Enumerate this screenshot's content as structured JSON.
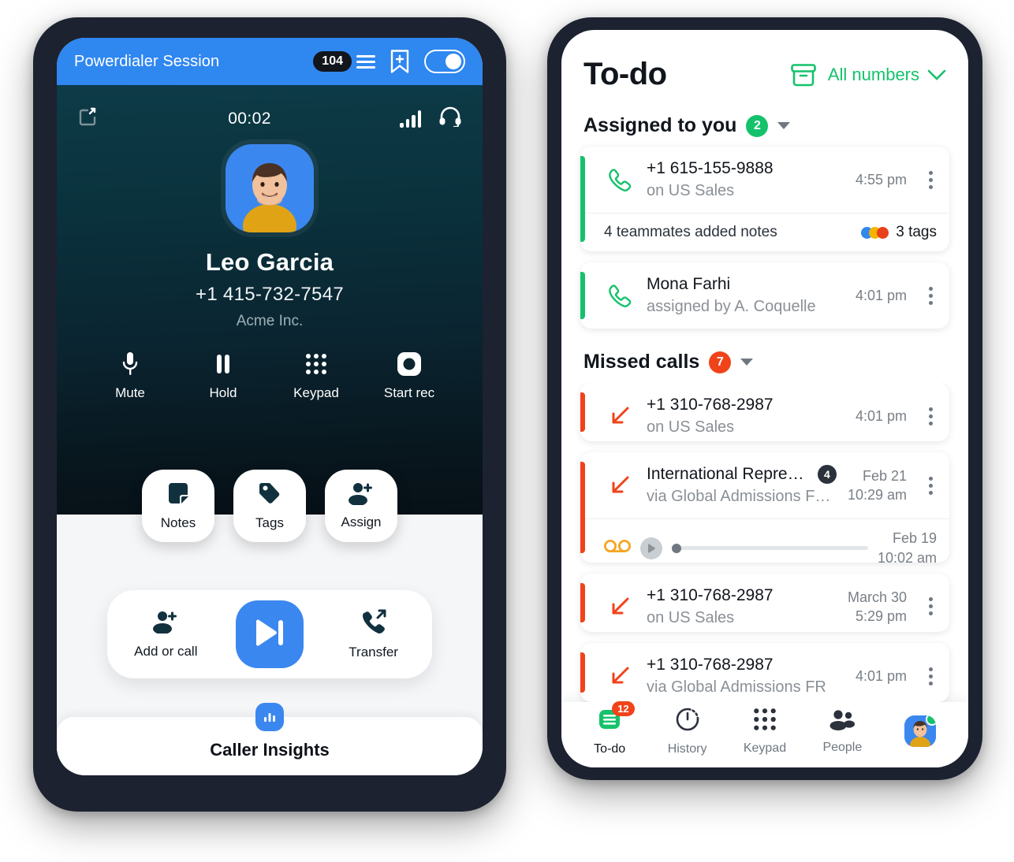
{
  "powerdialer": {
    "header": {
      "title": "Powerdialer Session",
      "queue_count": "104",
      "menu_icon": "hamburger-menu-icon",
      "bookmark_icon": "bookmark-add-icon",
      "toggle_state": "on"
    },
    "call": {
      "minimize_icon": "minimize-icon",
      "timer": "00:02",
      "signal_icon": "signal-bars-icon",
      "headset_icon": "headset-icon",
      "contact_name": "Leo Garcia",
      "contact_phone": "+1 415-732-7547",
      "contact_org": "Acme Inc.",
      "avatar_name": "contact-avatar"
    },
    "actions": [
      {
        "label": "Mute",
        "icon": "microphone-icon"
      },
      {
        "label": "Hold",
        "icon": "pause-icon"
      },
      {
        "label": "Keypad",
        "icon": "dialpad-icon"
      },
      {
        "label": "Start rec",
        "icon": "record-icon"
      }
    ],
    "pills": [
      {
        "label": "Notes",
        "icon": "note-icon"
      },
      {
        "label": "Tags",
        "icon": "tag-icon"
      },
      {
        "label": "Assign",
        "icon": "person-add-icon"
      }
    ],
    "dock": {
      "add_or_call": {
        "label": "Add or call",
        "icon": "person-add-icon"
      },
      "next_call": {
        "label": "",
        "icon": "skip-next-icon"
      },
      "transfer": {
        "label": "Transfer",
        "icon": "call-transfer-icon"
      }
    },
    "insights": {
      "label": "Caller Insights",
      "icon": "bar-chart-icon"
    },
    "colors": {
      "header_blue": "#2f87f0",
      "accent_blue": "#3b87f0",
      "call_bg_top": "#0d3b47",
      "call_bg_bottom": "#071017"
    }
  },
  "todo": {
    "header": {
      "title": "To-do",
      "archive_icon": "archive-box-icon",
      "filter_label": "All numbers",
      "filter_chevron_icon": "chevron-down-icon"
    },
    "sections": [
      {
        "title": "Assigned to you",
        "count": "2",
        "badge_color": "#15c26b",
        "caret_icon": "caret-down-icon",
        "items": [
          {
            "accent": "green",
            "icon": "phone-missed-inbound-icon",
            "title": "+1 615-155-9888",
            "subtitle": "on US Sales",
            "time": "4:55 pm",
            "time2": "",
            "count_badge": "",
            "kebab_icon": "more-vertical-icon",
            "footer": {
              "text": "4 teammates added notes",
              "tags_label": "3 tags",
              "tag_colors": [
                "#2f87f0",
                "#f4b400",
                "#e8411c"
              ]
            }
          },
          {
            "accent": "green",
            "icon": "phone-icon",
            "title": "Mona Farhi",
            "subtitle": "assigned by A. Coquelle",
            "time": "4:01 pm",
            "time2": "",
            "count_badge": "",
            "kebab_icon": "more-vertical-icon",
            "footer": null
          }
        ]
      },
      {
        "title": "Missed calls",
        "count": "7",
        "badge_color": "#f0431a",
        "caret_icon": "caret-down-icon",
        "items": [
          {
            "accent": "red",
            "icon": "call-missed-icon",
            "title": "+1 310-768-2987",
            "subtitle": "on US Sales",
            "time": "4:01 pm",
            "time2": "",
            "count_badge": "",
            "kebab_icon": "more-vertical-icon",
            "footer": null
          },
          {
            "accent": "red",
            "icon": "call-missed-icon",
            "title": "International Representat...",
            "subtitle": "via Global Admissions FR [In...",
            "time": "Feb 21",
            "time2": "10:29 am",
            "count_badge": "4",
            "kebab_icon": "more-vertical-icon",
            "voicemail": {
              "icon": "voicemail-icon",
              "play_icon": "play-icon",
              "progress": 3,
              "date": "Feb 19",
              "time": "10:02 am"
            },
            "footer": null
          },
          {
            "accent": "red",
            "icon": "call-missed-icon",
            "title": "+1 310-768-2987",
            "subtitle": "on US Sales",
            "time": "March 30",
            "time2": "5:29 pm",
            "count_badge": "",
            "kebab_icon": "more-vertical-icon",
            "footer": null
          },
          {
            "accent": "red",
            "icon": "call-missed-icon",
            "title": "+1 310-768-2987",
            "subtitle": "via Global Admissions FR",
            "time": "4:01 pm",
            "time2": "",
            "count_badge": "",
            "kebab_icon": "more-vertical-icon",
            "footer": null
          }
        ]
      }
    ],
    "tabbar": [
      {
        "label": "To-do",
        "icon": "todo-list-icon",
        "badge": "12",
        "active": true
      },
      {
        "label": "History",
        "icon": "history-clock-icon",
        "badge": "",
        "active": false
      },
      {
        "label": "Keypad",
        "icon": "dialpad-icon",
        "badge": "",
        "active": false
      },
      {
        "label": "People",
        "icon": "people-icon",
        "badge": "",
        "active": false
      },
      {
        "label": "",
        "icon": "user-avatar-icon",
        "badge": "",
        "active": false
      }
    ],
    "colors": {
      "green": "#15c26b",
      "red": "#f0431a",
      "text": "#11161d",
      "muted": "#8a9096"
    }
  }
}
